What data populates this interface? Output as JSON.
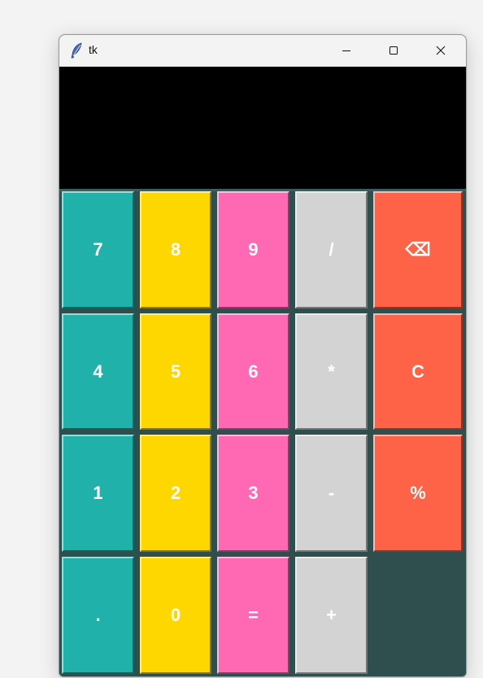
{
  "window": {
    "title": "tk",
    "app_icon": "feather-icon",
    "controls": {
      "minimize_icon": "minimize-icon",
      "maximize_icon": "maximize-icon",
      "close_icon": "close-icon"
    }
  },
  "display": {
    "value": "",
    "background": "#000000",
    "text_color": "#ffffff"
  },
  "keypad": {
    "background": "#2f4f4f",
    "colors": {
      "digits_col1": "#20b2aa",
      "digits_col2": "#ffd700",
      "digits_col3": "#ff69b4",
      "operators": "#d3d3d3",
      "functions": "#ff6347"
    },
    "keys": {
      "k7": "7",
      "k8": "8",
      "k9": "9",
      "divide": "/",
      "backspace": "⌫",
      "k4": "4",
      "k5": "5",
      "k6": "6",
      "multiply": "*",
      "clear": "C",
      "k1": "1",
      "k2": "2",
      "k3": "3",
      "subtract": "-",
      "percent": "%",
      "decimal": ".",
      "k0": "0",
      "equals": "=",
      "add": "+"
    }
  }
}
